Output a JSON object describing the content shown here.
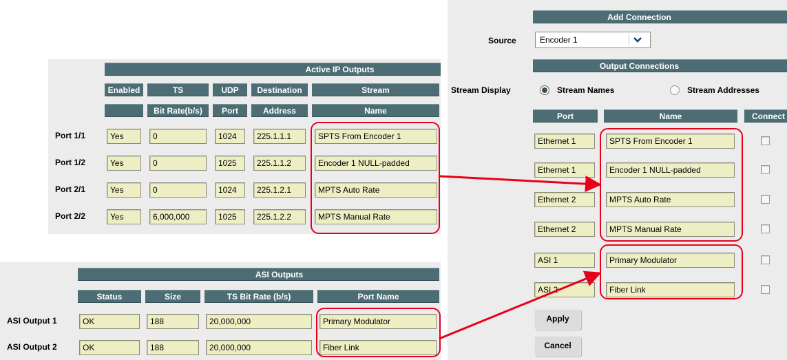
{
  "ip_outputs": {
    "title": "Active IP Outputs",
    "headers_row1": [
      "Enabled",
      "TS",
      "UDP",
      "Destination",
      "Stream"
    ],
    "headers_row2": [
      "",
      "Bit Rate(b/s)",
      "Port",
      "Address",
      "Name"
    ],
    "rows": [
      {
        "label": "Port 1/1",
        "enabled": "Yes",
        "bitrate": "0",
        "port": "1024",
        "address": "225.1.1.1",
        "name": "SPTS From Encoder 1"
      },
      {
        "label": "Port 1/2",
        "enabled": "Yes",
        "bitrate": "0",
        "port": "1025",
        "address": "225.1.1.2",
        "name": "Encoder 1 NULL-padded"
      },
      {
        "label": "Port 2/1",
        "enabled": "Yes",
        "bitrate": "0",
        "port": "1024",
        "address": "225.1.2.1",
        "name": "MPTS Auto Rate"
      },
      {
        "label": "Port 2/2",
        "enabled": "Yes",
        "bitrate": "6,000,000",
        "port": "1025",
        "address": "225.1.2.2",
        "name": "MPTS Manual Rate"
      }
    ]
  },
  "asi_outputs": {
    "title": "ASI Outputs",
    "headers": [
      "Status",
      "Size",
      "TS Bit Rate (b/s)",
      "Port Name"
    ],
    "rows": [
      {
        "label": "ASI Output 1",
        "status": "OK",
        "size": "188",
        "bitrate": "20,000,000",
        "name": "Primary Modulator"
      },
      {
        "label": "ASI Output 2",
        "status": "OK",
        "size": "188",
        "bitrate": "20,000,000",
        "name": "Fiber Link"
      }
    ]
  },
  "add_connection": {
    "title": "Add Connection",
    "source_label": "Source",
    "source_value": "Encoder 1",
    "output_title": "Output Connections",
    "stream_display_label": "Stream Display",
    "radio_names": "Stream Names",
    "radio_addresses": "Stream Addresses",
    "radio_selected": "Stream Names",
    "col_headers": [
      "Port",
      "Name",
      "Connect"
    ],
    "rows": [
      {
        "port": "Ethernet 1",
        "name": "SPTS From Encoder 1"
      },
      {
        "port": "Ethernet 1",
        "name": "Encoder 1 NULL-padded"
      },
      {
        "port": "Ethernet 2",
        "name": "MPTS Auto Rate"
      },
      {
        "port": "Ethernet 2",
        "name": "MPTS Manual Rate"
      },
      {
        "port": "ASI 1",
        "name": "Primary Modulator"
      },
      {
        "port": "ASI 2",
        "name": "Fiber Link"
      }
    ],
    "apply_label": "Apply",
    "cancel_label": "Cancel"
  },
  "colors": {
    "header": "#4d6d74",
    "field": "#eeeec4",
    "panel": "#ececec",
    "highlight": "#e8001a"
  },
  "icons": {
    "dropdown": "chevron-down-icon",
    "arrow": "arrow-icon"
  }
}
